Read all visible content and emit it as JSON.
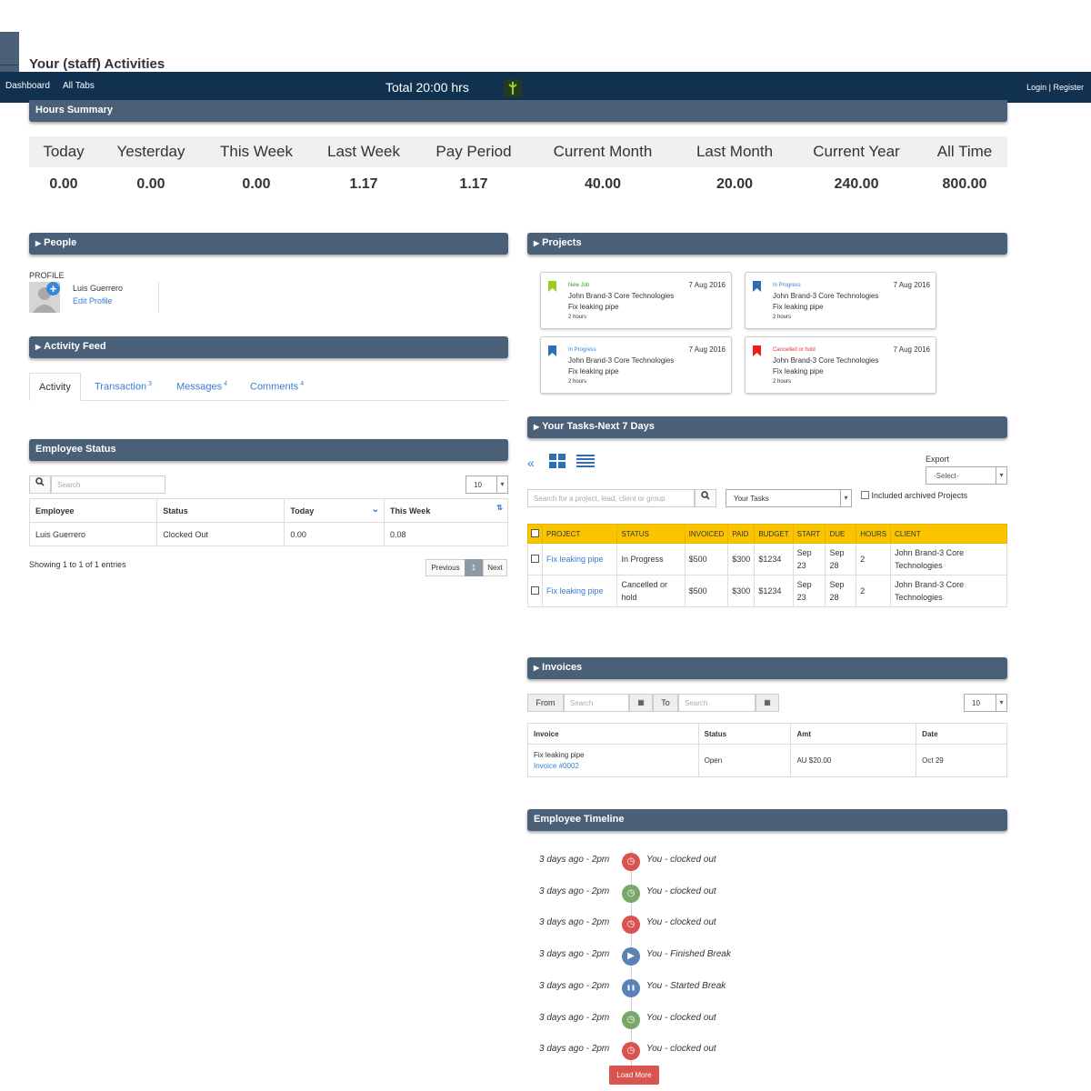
{
  "page": {
    "title": "Your (staff) Activities"
  },
  "topbar": {
    "dashboard": "Dashboard",
    "all_tabs": "All Tabs",
    "total": "Total 20:00 hrs",
    "login": "Login",
    "separator": "|",
    "register": "Register"
  },
  "hours_summary": {
    "title": "Hours Summary",
    "columns": [
      {
        "label": "Today",
        "value": "0.00"
      },
      {
        "label": "Yesterday",
        "value": "0.00"
      },
      {
        "label": "This Week",
        "value": "0.00"
      },
      {
        "label": "Last Week",
        "value": "1.17"
      },
      {
        "label": "Pay Period",
        "value": "1.17"
      },
      {
        "label": "Current Month",
        "value": "40.00"
      },
      {
        "label": "Last Month",
        "value": "20.00"
      },
      {
        "label": "Current Year",
        "value": "240.00"
      },
      {
        "label": "All Time",
        "value": "800.00"
      }
    ]
  },
  "people": {
    "title": "People",
    "profile_label": "PROFILE",
    "name": "Luis Guerrero",
    "edit_link": "Edit Profile"
  },
  "activity_feed": {
    "title": "Activity Feed",
    "tabs": [
      {
        "label": "Activity",
        "count": ""
      },
      {
        "label": "Transaction",
        "count": "3"
      },
      {
        "label": "Messages",
        "count": "4"
      },
      {
        "label": "Comments",
        "count": "4"
      }
    ]
  },
  "employee_status": {
    "title": "Employee Status",
    "search_placeholder": "Search",
    "page_size": "10",
    "headers": [
      "Employee",
      "Status",
      "Today",
      "This Week"
    ],
    "rows": [
      [
        "Luis Guerrero",
        "Clocked Out",
        "0.00",
        "0.08"
      ]
    ],
    "showing": "Showing 1 to 1 of 1 entries",
    "previous": "Previous",
    "page": "1",
    "next": "Next"
  },
  "projects": {
    "title": "Projects",
    "cards": [
      {
        "status": "New Job",
        "status_color": "#2aa02a",
        "flag_color": "#9ccc1f",
        "date": "7 Aug 2016",
        "client": "John Brand-3 Core Technologies",
        "task": "Fix leaking pipe",
        "hours": "2 hours"
      },
      {
        "status": "In Progress",
        "status_color": "#3a7bd5",
        "flag_color": "#2f6db5",
        "date": "7 Aug 2016",
        "client": "John Brand-3 Core Technologies",
        "task": "Fix leaking pipe",
        "hours": "2 hours"
      },
      {
        "status": "In Progress",
        "status_color": "#3a7bd5",
        "flag_color": "#2f6db5",
        "date": "7 Aug 2016",
        "client": "John Brand-3 Core Technologies",
        "task": "Fix leaking pipe",
        "hours": "2 hours"
      },
      {
        "status": "Cancelled or hold",
        "status_color": "#e03030",
        "flag_color": "#e82020",
        "date": "7 Aug 2016",
        "client": "John Brand-3 Core Technologies",
        "task": "Fix leaking pipe",
        "hours": "2 hours"
      }
    ]
  },
  "tasks": {
    "title": "Your Tasks-Next 7 Days",
    "export_label": "Export",
    "export_select": "-Select-",
    "search_placeholder": "Search for a project, lead, client or group",
    "filter_select": "Your Tasks",
    "archived_label": "Included archived Projects",
    "headers": [
      "PROJECT",
      "STATUS",
      "INVOICED",
      "PAID",
      "BUDGET",
      "START",
      "DUE",
      "HOURS",
      "CLIENT"
    ],
    "rows": [
      {
        "project": "Fix leaking pipe",
        "status": "In Progress",
        "invoiced": "$500",
        "paid": "$300",
        "budget": "$1234",
        "start": "Sep 23",
        "due": "Sep 28",
        "hours": "2",
        "client": "John Brand-3 Core Technologies"
      },
      {
        "project": "Fix leaking pipe",
        "status": "Cancelled or hold",
        "invoiced": "$500",
        "paid": "$300",
        "budget": "$1234",
        "start": "Sep 23",
        "due": "Sep 28",
        "hours": "2",
        "client": "John Brand-3 Core Technologies"
      }
    ]
  },
  "invoices": {
    "title": "Invoices",
    "from_label": "From",
    "to_label": "To",
    "from_placeholder": "Search",
    "to_placeholder": "Search",
    "page_size": "10",
    "headers": [
      "Invoice",
      "Status",
      "Amt",
      "Date"
    ],
    "rows": [
      {
        "name": "Fix leaking pipe",
        "number": "Invoice #0002",
        "status": "Open",
        "amount": "AU $20.00",
        "date": "Oct 29"
      }
    ]
  },
  "timeline": {
    "title": "Employee Timeline",
    "entries": [
      {
        "when": "3 days ago - 2pm",
        "what": "You - clocked out",
        "icon": "clock-icon",
        "color": "#d9534f"
      },
      {
        "when": "3 days ago - 2pm",
        "what": "You - clocked out",
        "icon": "clock-icon",
        "color": "#7aa86a"
      },
      {
        "when": "3 days ago - 2pm",
        "what": "You - clocked out",
        "icon": "clock-icon",
        "color": "#d9534f"
      },
      {
        "when": "3 days ago - 2pm",
        "what": "You - Finished Break",
        "icon": "play-icon",
        "color": "#5b82b5"
      },
      {
        "when": "3 days ago - 2pm",
        "what": "You - Started Break",
        "icon": "pause-icon",
        "color": "#5b82b5"
      },
      {
        "when": "3 days ago - 2pm",
        "what": "You - clocked out",
        "icon": "clock-icon",
        "color": "#7aa86a"
      },
      {
        "when": "3 days ago - 2pm",
        "what": "You - clocked out",
        "icon": "clock-icon",
        "color": "#d9534f"
      }
    ],
    "load_more": "Load More"
  }
}
